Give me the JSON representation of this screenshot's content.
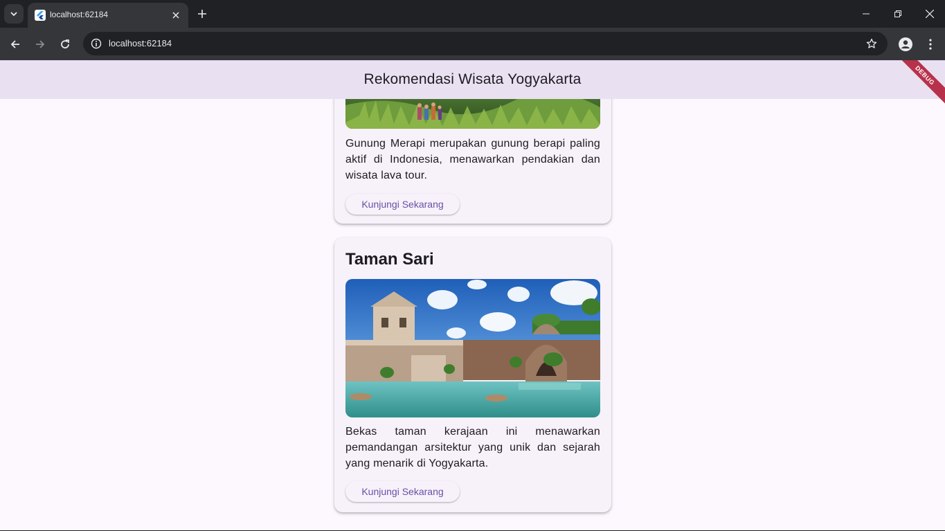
{
  "browser": {
    "tab_title": "localhost:62184",
    "url": "localhost:62184"
  },
  "app": {
    "title": "Rekomendasi Wisata Yogyakarta",
    "debug_banner": "DEBUG"
  },
  "cards": [
    {
      "description": "Gunung Merapi merupakan gunung berapi paling aktif di Indonesia, menawarkan pendakian dan wisata lava tour.",
      "button_label": "Kunjungi Sekarang"
    },
    {
      "title": "Taman Sari",
      "description": "Bekas taman kerajaan ini menawarkan pemandangan arsitektur yang unik dan sejarah yang menarik di Yogyakarta.",
      "button_label": "Kunjungi Sekarang"
    }
  ]
}
